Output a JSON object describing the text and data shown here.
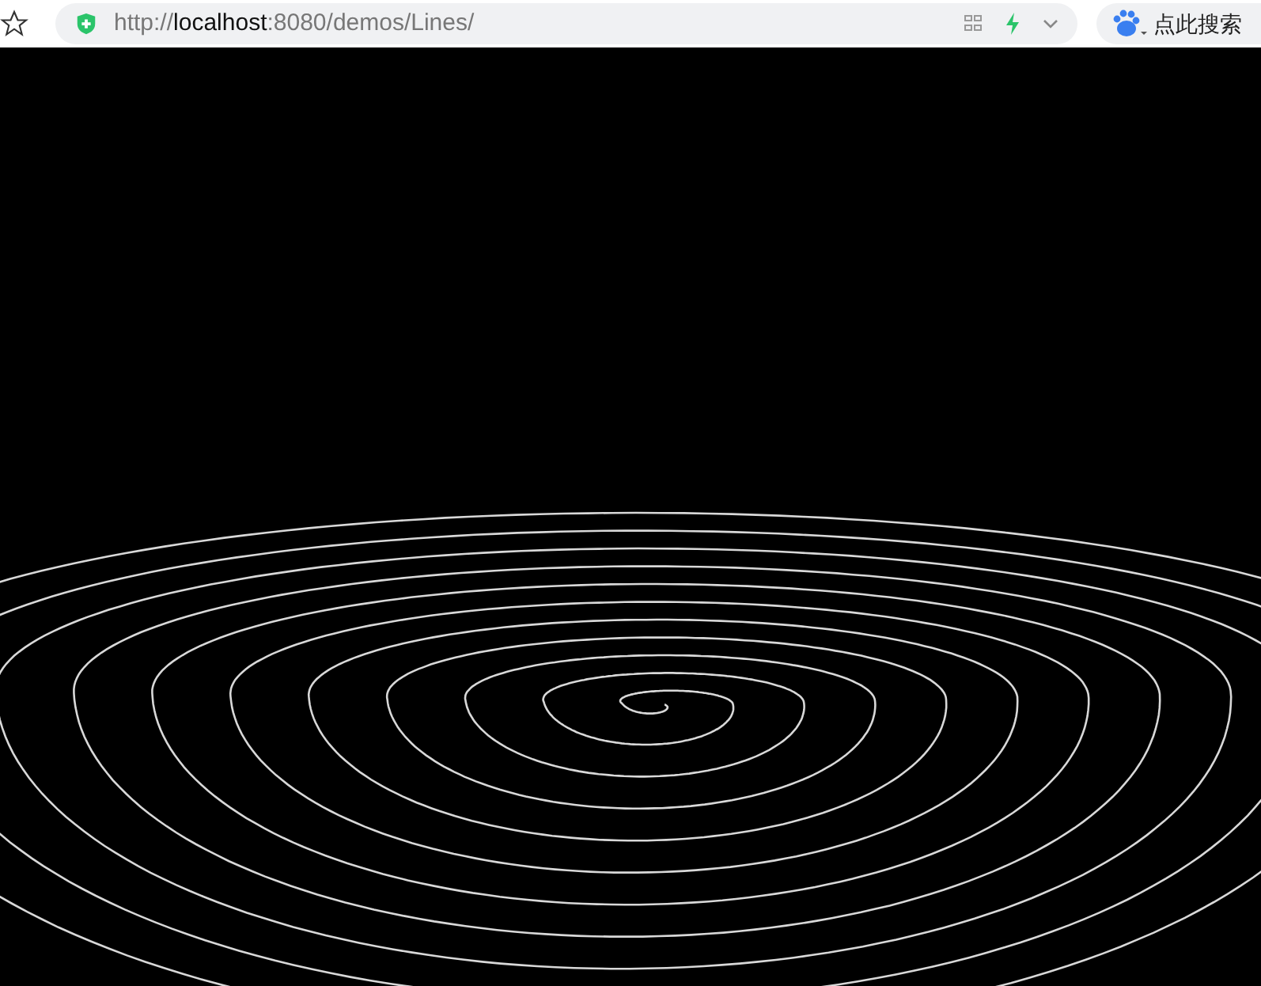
{
  "address_bar": {
    "url": "http://**localhost**:8080/demos/Lines/"
  },
  "search_button": {
    "label": "点此搜索"
  }
}
